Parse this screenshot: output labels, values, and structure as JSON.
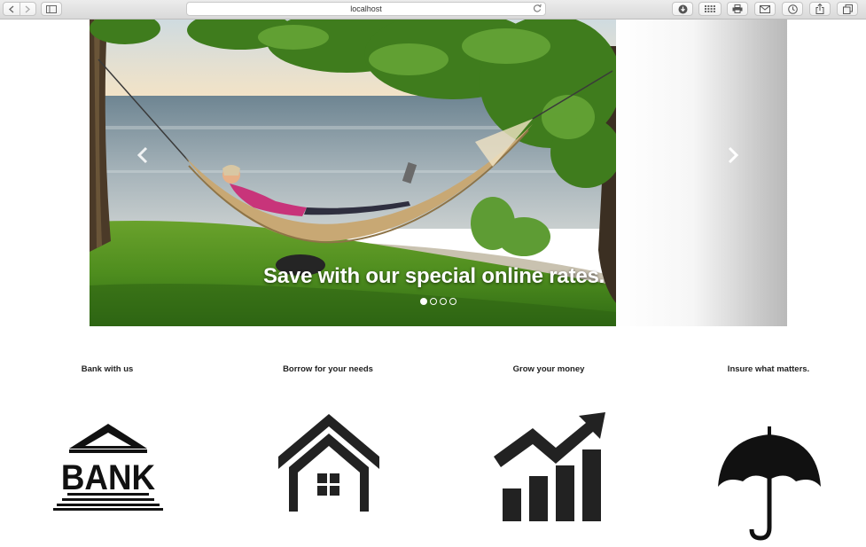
{
  "browser": {
    "url": "localhost"
  },
  "carousel": {
    "caption": "Save with our special online rates.",
    "slides": 4,
    "active_index": 0
  },
  "features": [
    {
      "label": "Bank with us",
      "icon": "bank-icon",
      "icon_text": "BANK"
    },
    {
      "label": "Borrow for your needs",
      "icon": "house-icon"
    },
    {
      "label": "Grow your money",
      "icon": "growth-chart-icon"
    },
    {
      "label": "Insure what matters.",
      "icon": "umbrella-icon"
    }
  ]
}
